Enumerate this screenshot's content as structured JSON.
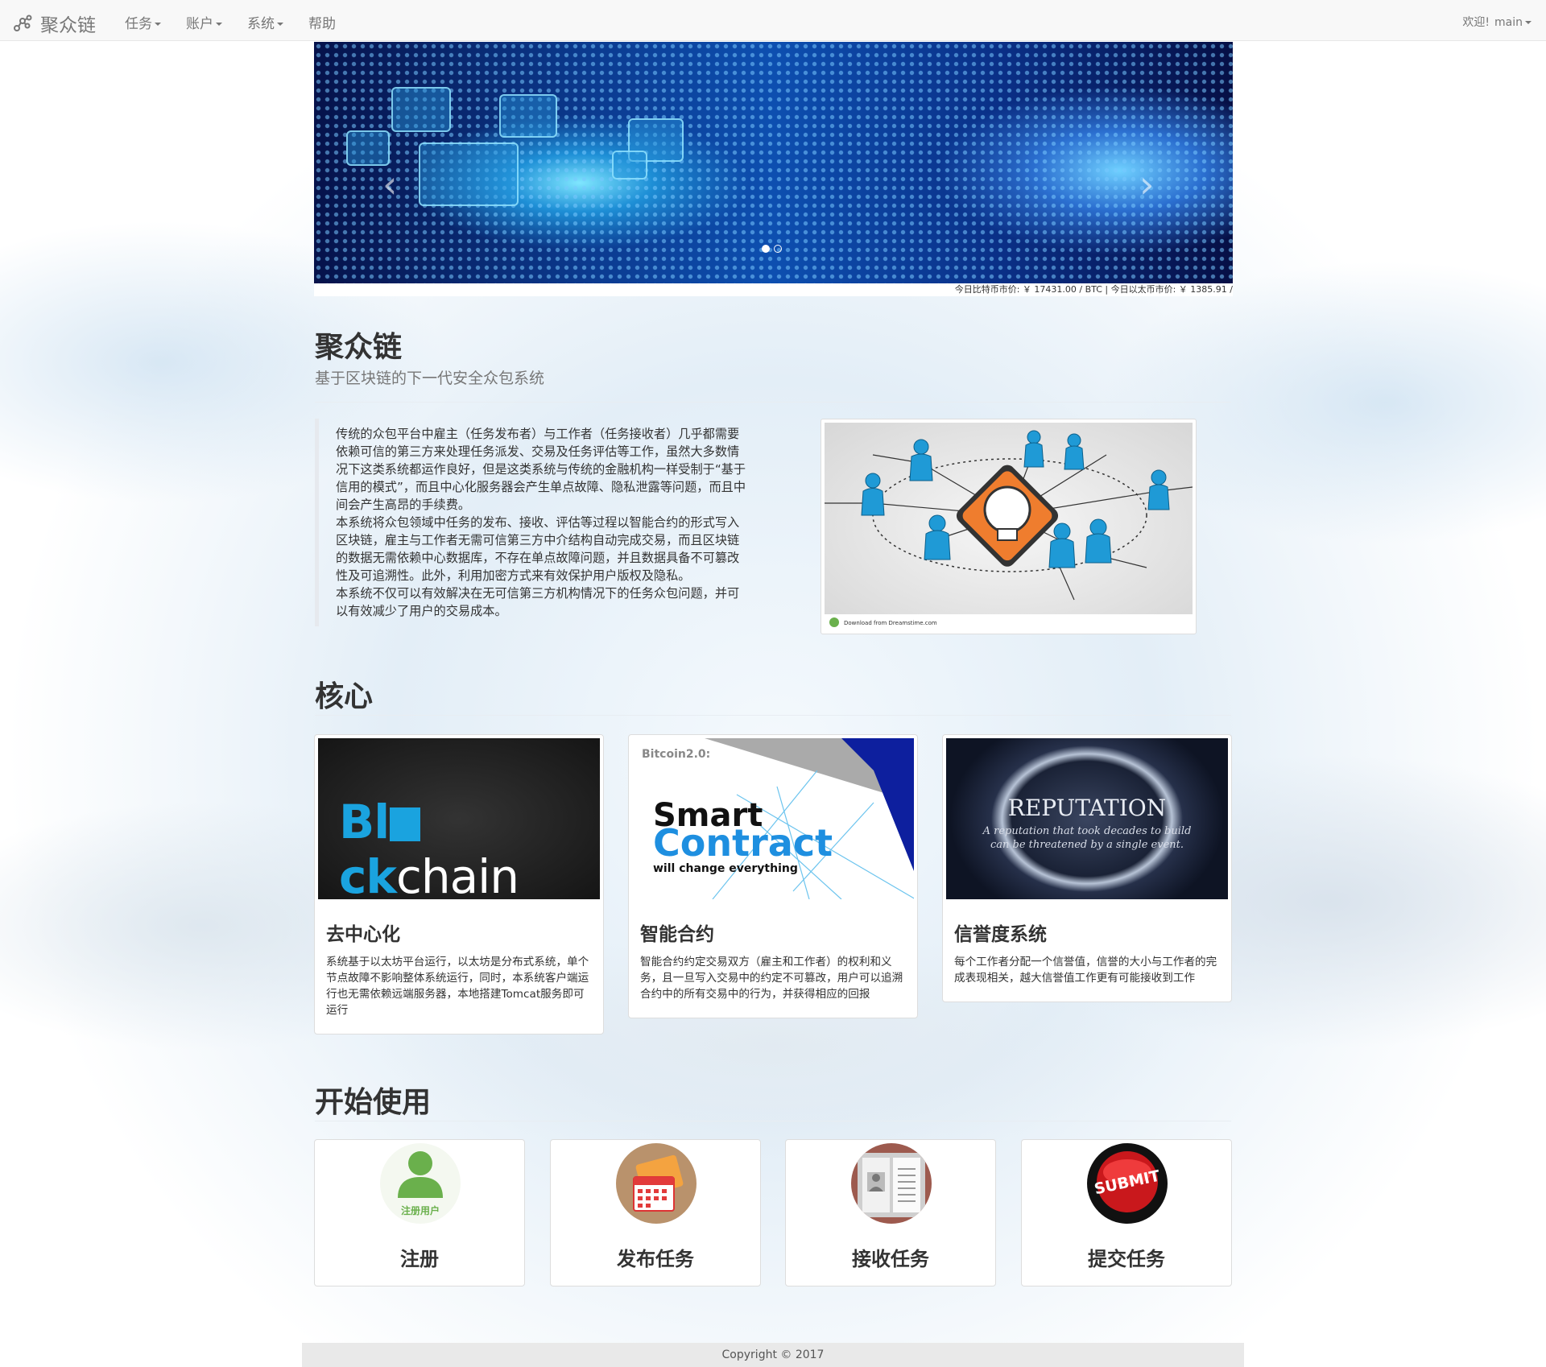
{
  "navbar": {
    "brand": "聚众链",
    "menu": [
      {
        "label": "任务",
        "dropdown": true
      },
      {
        "label": "账户",
        "dropdown": true
      },
      {
        "label": "系统",
        "dropdown": true
      },
      {
        "label": "帮助",
        "dropdown": false
      }
    ],
    "welcome": "欢迎!",
    "user": "main"
  },
  "carousel": {
    "slide_count": 2,
    "active_index": 0,
    "prev_symbol": "‹",
    "next_symbol": "›"
  },
  "price_bar": "今日比特币市价: ￥ 17431.00 / BTC  |  今日以太币市价: ￥ 1385.91 /",
  "intro": {
    "title": "聚众链",
    "subtitle": "基于区块链的下一代安全众包系统",
    "paragraphs": [
      "传统的众包平台中雇主（任务发布者）与工作者（任务接收者）几乎都需要依赖可信的第三方来处理任务派发、交易及任务评估等工作，虽然大多数情况下这类系统都运作良好，但是这类系统与传统的金融机构一样受制于“基于信用的模式”，而且中心化服务器会产生单点故障、隐私泄露等问题，而且中间会产生高昂的手续费。",
      "本系统将众包领域中任务的发布、接收、评估等过程以智能合约的形式写入区块链，雇主与工作者无需可信第三方中介结构自动完成交易，而且区块链的数据无需依赖中心数据库，不存在单点故障问题，并且数据具备不可篡改性及可追溯性。此外，利用加密方式来有效保护用户版权及隐私。",
      "本系统不仅可以有效解决在无可信第三方机构情况下的任务众包问题，并可以有效减少了用户的交易成本。"
    ],
    "image_footer_left": "Download from Dreamstime.com"
  },
  "core": {
    "title": "核心",
    "cards": [
      {
        "thumb_text_a": "Bl",
        "thumb_text_b": "ck",
        "thumb_text_c": "chain",
        "title": "去中心化",
        "text": "系统基于以太坊平台运行，以太坊是分布式系统，单个节点故障不影响整体系统运行，同时，本系统客户端运行也无需依赖远端服务器，本地搭建Tomcat服务即可运行"
      },
      {
        "thumb_tag": "Bitcoin2.0:",
        "thumb_line1": "Smart",
        "thumb_line2": "Contract",
        "thumb_line3": "will change everything",
        "title": "智能合约",
        "text": "智能合约约定交易双方（雇主和工作者）的权利和义务，且一旦写入交易中的约定不可篡改，用户可以追溯合约中的所有交易中的行为，并获得相应的回报"
      },
      {
        "thumb_title": "REPUTATION",
        "thumb_quote1": "A reputation that took decades to build",
        "thumb_quote2": "can be threatened by a single event.",
        "title": "信誉度系统",
        "text": "每个工作者分配一个信誉值，信誉的大小与工作者的完成表现相关，越大信誉值工作更有可能接收到工作"
      }
    ]
  },
  "start": {
    "title": "开始使用",
    "tiles": [
      {
        "label": "注册",
        "icon_caption": "注册用户"
      },
      {
        "label": "发布任务"
      },
      {
        "label": "接收任务"
      },
      {
        "label": "提交任务",
        "icon_caption": "SUBMIT"
      }
    ]
  },
  "footer": "Copyright © 2017"
}
